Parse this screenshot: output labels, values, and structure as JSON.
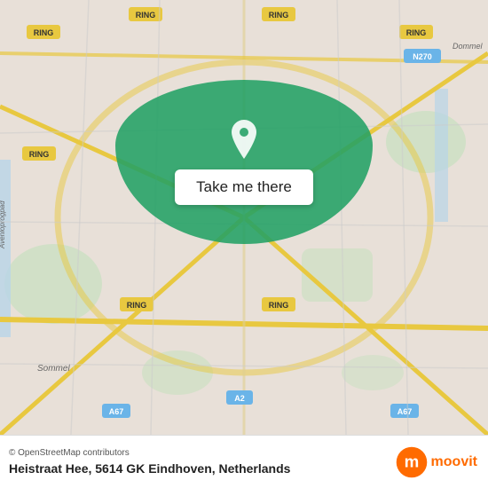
{
  "map": {
    "background_color": "#e8e0d8",
    "center_lat": 51.44,
    "center_lon": 5.47
  },
  "callout": {
    "button_label": "Take me there",
    "pin_color": "#ffffff",
    "background_color": "rgba(34,160,100,0.88)"
  },
  "footer": {
    "attribution": "© OpenStreetMap contributors",
    "address": "Heistraat Hee, 5614 GK Eindhoven, Netherlands",
    "logo_text": "moovit"
  }
}
